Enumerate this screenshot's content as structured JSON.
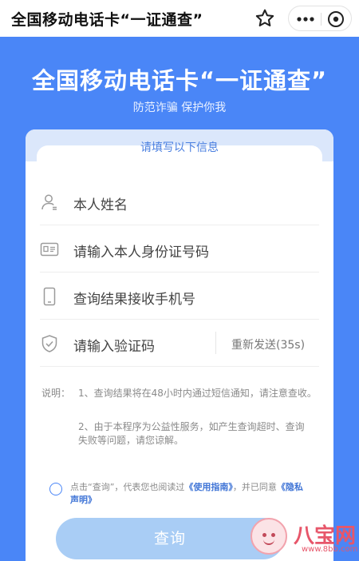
{
  "topbar": {
    "title": "全国移动电话卡“一证通查”",
    "star_icon": "star-icon",
    "more_icon": "more-icon",
    "close_icon": "close-icon"
  },
  "hero": {
    "title": "全国移动电话卡“一证通查”",
    "subtitle": "防范诈骗 保护你我"
  },
  "card": {
    "header": "请填写以下信息",
    "fields": [
      {
        "icon": "person-icon",
        "placeholder": "本人姓名"
      },
      {
        "icon": "id-card-icon",
        "placeholder": "请输入本人身份证号码"
      },
      {
        "icon": "phone-icon",
        "placeholder": "查询结果接收手机号"
      },
      {
        "icon": "shield-icon",
        "placeholder": "请输入验证码",
        "action": "重新发送(35s)"
      }
    ],
    "notes": {
      "label": "说明：",
      "items": [
        "1、查询结果将在48小时内通过短信通知，请注意查收。",
        "2、由于本程序为公益性服务，如产生查询超时、查询失败等问题，请您谅解。"
      ]
    },
    "agreement": {
      "prefix": "点击“查询”，代表您也阅读过",
      "link1": "《使用指南》",
      "middle": "，并已同意",
      "link2": "《隐私声明》"
    },
    "submit_label": "查询"
  },
  "watermark": {
    "brand": "八宝网",
    "url": "www.8bb.com"
  },
  "colors": {
    "background": "#4a86f7",
    "submit": "#a9cdf5",
    "link": "#3f74d6",
    "header_bg": "#dbe7fb"
  }
}
